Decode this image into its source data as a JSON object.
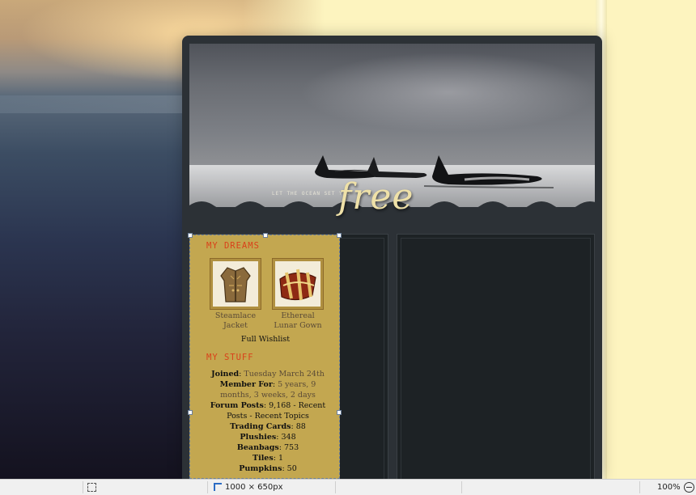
{
  "header": {
    "tagline": "LET THE OCEAN SET YOU",
    "tagline_word": "free"
  },
  "sidebar": {
    "dreams_title": "MY DREAMS",
    "wishlist": [
      {
        "name": "Steamlace Jacket"
      },
      {
        "name": "Ethereal Lunar Gown"
      }
    ],
    "full_wishlist_link": "Full Wishlist",
    "stuff_title": "MY STUFF",
    "stats": {
      "joined_label": "Joined",
      "joined_value": "Tuesday March 24th",
      "member_for_label": "Member For",
      "member_for_value": "5 years, 9 months, 3 weeks, 2 days",
      "forum_posts_label": "Forum Posts",
      "forum_posts_value": "9,168",
      "recent_posts_link": "Recent Posts",
      "recent_topics_link": "Recent Topics",
      "trading_cards_label": "Trading Cards",
      "trading_cards_value": "88",
      "plushies_label": "Plushies",
      "plushies_value": "348",
      "beanbags_label": "Beanbags",
      "beanbags_value": "753",
      "tiles_label": "Tiles",
      "tiles_value": "1",
      "pumpkins_label": "Pumpkins",
      "pumpkins_value": "50"
    }
  },
  "statusbar": {
    "dimensions": "1000 × 650px",
    "zoom": "100%"
  },
  "colors": {
    "sidebar_gold": "#c3a750",
    "section_title_orange": "#d9411a",
    "free_text_cream": "#efe1a8"
  }
}
